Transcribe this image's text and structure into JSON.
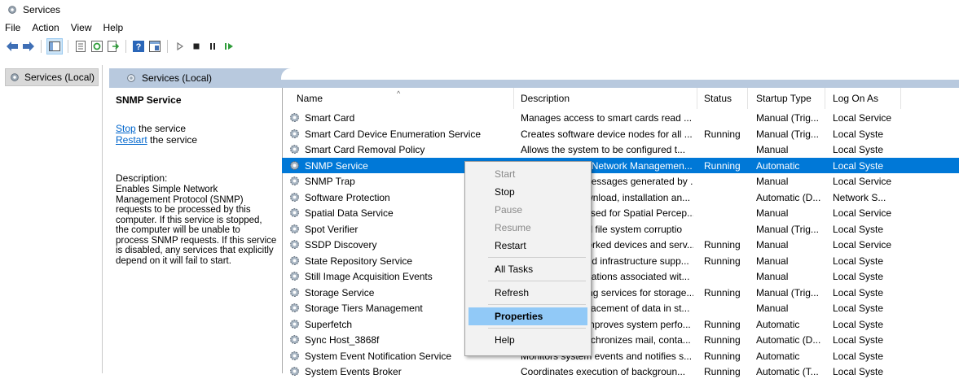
{
  "window": {
    "title": "Services"
  },
  "menu": [
    "File",
    "Action",
    "View",
    "Help"
  ],
  "toolbar": [
    "back-icon",
    "forward-icon",
    "show-hide-console-tree-icon",
    "properties-icon",
    "refresh-icon",
    "export-list-icon",
    "help-icon",
    "description-view-icon",
    "start-service-icon",
    "stop-service-icon",
    "pause-service-icon",
    "restart-service-icon"
  ],
  "tree": {
    "root": "Services (Local)"
  },
  "panel": {
    "header": "Services (Local)"
  },
  "description": {
    "service_name": "SNMP Service",
    "stop_link": "Stop",
    "stop_rest": " the service",
    "restart_link": "Restart",
    "restart_rest": " the service",
    "label": "Description:",
    "lines": [
      "Enables Simple Network",
      "Management Protocol (SNMP)",
      "requests to be processed by this",
      "computer. If this service is stopped,",
      "the computer will be unable to",
      "process SNMP requests. If this service",
      "is disabled, any services that explicitly",
      "depend on it will fail to start."
    ]
  },
  "columns": {
    "name": "Name",
    "description": "Description",
    "status": "Status",
    "startup": "Startup Type",
    "logon": "Log On As",
    "sort_indicator": "^"
  },
  "services": [
    {
      "name": "Smart Card",
      "description": "Manages access to smart cards read ...",
      "status": "",
      "startup": "Manual (Trig...",
      "logon": "Local Service"
    },
    {
      "name": "Smart Card Device Enumeration Service",
      "description": "Creates software device nodes for all ...",
      "status": "Running",
      "startup": "Manual (Trig...",
      "logon": "Local Syste"
    },
    {
      "name": "Smart Card Removal Policy",
      "description": "Allows the system to be configured t...",
      "status": "",
      "startup": "Manual",
      "logon": "Local Syste"
    },
    {
      "name": "SNMP Service",
      "description": "Enables Simple Network Managemen...",
      "status": "Running",
      "startup": "Automatic",
      "logon": "Local Syste",
      "selected": true
    },
    {
      "name": "SNMP Trap",
      "description": "Receives trap messages generated by ...",
      "status": "",
      "startup": "Manual",
      "logon": "Local Service"
    },
    {
      "name": "Software Protection",
      "description": "Enables the download, installation an...",
      "status": "",
      "startup": "Automatic (D...",
      "logon": "Network S..."
    },
    {
      "name": "Spatial Data Service",
      "description": "This service is used for Spatial Percep...",
      "status": "",
      "startup": "Manual",
      "logon": "Local Service"
    },
    {
      "name": "Spot Verifier",
      "description": "Verifies potential file system corruptio",
      "status": "",
      "startup": "Manual (Trig...",
      "logon": "Local Syste"
    },
    {
      "name": "SSDP Discovery",
      "description": "Discovers networked devices and serv...",
      "status": "Running",
      "startup": "Manual",
      "logon": "Local Service"
    },
    {
      "name": "State Repository Service",
      "description": "Provides required infrastructure supp...",
      "status": "Running",
      "startup": "Manual",
      "logon": "Local Syste"
    },
    {
      "name": "Still Image Acquisition Events",
      "description": "Launches applications associated wit...",
      "status": "",
      "startup": "Manual",
      "logon": "Local Syste"
    },
    {
      "name": "Storage Service",
      "description": "Provides enabling services for storage...",
      "status": "Running",
      "startup": "Manual (Trig...",
      "logon": "Local Syste"
    },
    {
      "name": "Storage Tiers Management",
      "description": "Optimizes the placement of data in st...",
      "status": "",
      "startup": "Manual",
      "logon": "Local Syste"
    },
    {
      "name": "Superfetch",
      "description": "Maintains and improves system perfo...",
      "status": "Running",
      "startup": "Automatic",
      "logon": "Local Syste"
    },
    {
      "name": "Sync Host_3868f",
      "description": "This service synchronizes mail, conta...",
      "status": "Running",
      "startup": "Automatic (D...",
      "logon": "Local Syste"
    },
    {
      "name": "System Event Notification Service",
      "description": "Monitors system events and notifies s...",
      "status": "Running",
      "startup": "Automatic",
      "logon": "Local Syste"
    },
    {
      "name": "System Events Broker",
      "description": "Coordinates execution of backgroun...",
      "status": "Running",
      "startup": "Automatic (T...",
      "logon": "Local Syste"
    }
  ],
  "context_menu": [
    {
      "label": "Start",
      "enabled": false
    },
    {
      "label": "Stop",
      "enabled": true
    },
    {
      "label": "Pause",
      "enabled": false
    },
    {
      "label": "Resume",
      "enabled": false
    },
    {
      "label": "Restart",
      "enabled": true
    },
    {
      "separator": true
    },
    {
      "label": "All Tasks",
      "enabled": true,
      "submenu": true
    },
    {
      "separator": true
    },
    {
      "label": "Refresh",
      "enabled": true
    },
    {
      "separator": true
    },
    {
      "label": "Properties",
      "enabled": true,
      "highlighted": true
    },
    {
      "separator": true
    },
    {
      "label": "Help",
      "enabled": true
    }
  ],
  "colors": {
    "selection": "#0078d7",
    "panel_header": "#b8c9de",
    "menu_highlight": "#91c9f7",
    "link": "#0066cc"
  }
}
